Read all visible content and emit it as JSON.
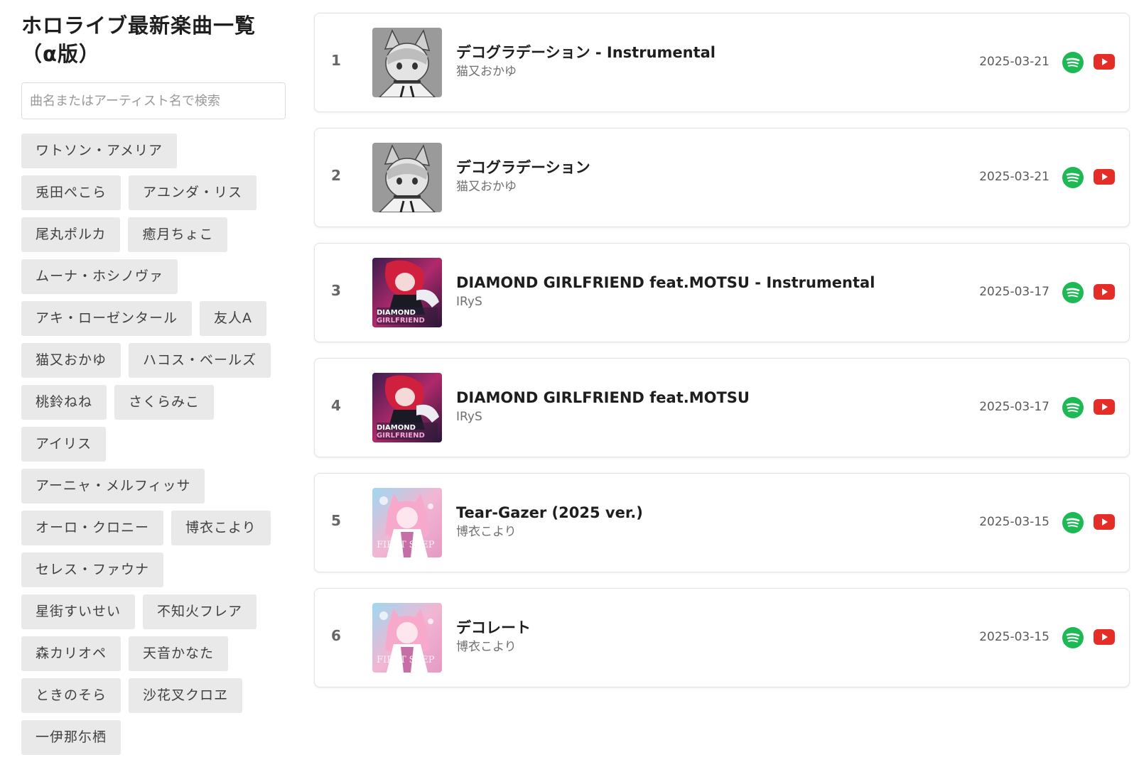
{
  "site": {
    "title": "ホロライブ最新楽曲一覧（α版）",
    "search_placeholder": "曲名またはアーティスト名で検索"
  },
  "artist_tags": [
    "ワトソン・アメリア",
    "兎田ぺこら",
    "アユンダ・リス",
    "尾丸ポルカ",
    "癒月ちょこ",
    "ムーナ・ホシノヴァ",
    "アキ・ローゼンタール",
    "友人A",
    "猫又おかゆ",
    "ハコス・ベールズ",
    "桃鈴ねね",
    "さくらみこ",
    "アイリス",
    "アーニャ・メルフィッサ",
    "オーロ・クロニー",
    "博衣こより",
    "セレス・ファウナ",
    "星街すいせい",
    "不知火フレア",
    "森カリオペ",
    "天音かなた",
    "ときのそら",
    "沙花叉クロヱ",
    "一伊那尓栖"
  ],
  "songs": [
    {
      "rank": "1",
      "title": "デコグラデーション - Instrumental",
      "artist": "猫又おかゆ",
      "date": "2025-03-21",
      "cover": "okayu-grey-icon"
    },
    {
      "rank": "2",
      "title": "デコグラデーション",
      "artist": "猫又おかゆ",
      "date": "2025-03-21",
      "cover": "okayu-grey-icon"
    },
    {
      "rank": "3",
      "title": "DIAMOND GIRLFRIEND feat.MOTSU - Instrumental",
      "artist": "IRyS",
      "date": "2025-03-17",
      "cover": "diamond-girlfriend-art-icon"
    },
    {
      "rank": "4",
      "title": "DIAMOND GIRLFRIEND feat.MOTSU",
      "artist": "IRyS",
      "date": "2025-03-17",
      "cover": "diamond-girlfriend-art-icon"
    },
    {
      "rank": "5",
      "title": "Tear-Gazer (2025 ver.)",
      "artist": "博衣こより",
      "date": "2025-03-15",
      "cover": "koyori-pink-art-icon"
    },
    {
      "rank": "6",
      "title": "デコレート",
      "artist": "博衣こより",
      "date": "2025-03-15",
      "cover": "koyori-pink-art-icon"
    }
  ],
  "icons": {
    "spotify": "spotify-icon",
    "youtube": "youtube-icon"
  },
  "colors": {
    "spotify": "#1db954",
    "youtube": "#e52d27",
    "tag_bg": "#e9e9e9"
  }
}
